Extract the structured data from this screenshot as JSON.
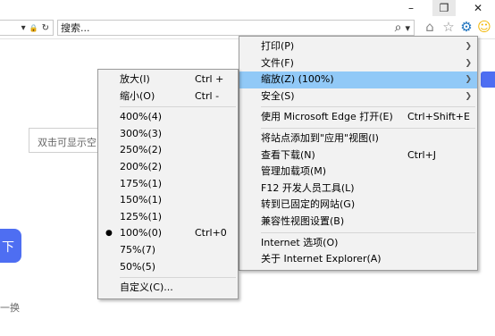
{
  "window": {
    "minimize_glyph": "–",
    "restore_glyph": "❐",
    "close_glyph": "✕"
  },
  "address": {
    "dropdown_glyph": "▾",
    "lock_glyph": "🔒",
    "refresh_glyph": "↻"
  },
  "search": {
    "placeholder": "搜索...",
    "search_glyph": "⌕",
    "dropdown_glyph": "▾"
  },
  "toolbar": {
    "home_glyph": "⌂",
    "favorites_glyph": "☆",
    "tools_glyph": "⚙",
    "smiley_glyph": "☺"
  },
  "page": {
    "input_placeholder": "双击可显示空白",
    "button_label": "下",
    "link_text": "一换"
  },
  "main_menu": {
    "items": [
      {
        "label": "打印(P)",
        "submenu": true
      },
      {
        "label": "文件(F)",
        "submenu": true
      },
      {
        "label": "缩放(Z) (100%)",
        "submenu": true,
        "highlighted": true
      },
      {
        "label": "安全(S)",
        "submenu": true
      },
      {
        "separator": true
      },
      {
        "label": "使用 Microsoft Edge 打开(E)",
        "shortcut": "Ctrl+Shift+E"
      },
      {
        "separator": true
      },
      {
        "label": "将站点添加到\"应用\"视图(I)"
      },
      {
        "label": "查看下载(N)",
        "shortcut": "Ctrl+J"
      },
      {
        "label": "管理加载项(M)"
      },
      {
        "label": "F12 开发人员工具(L)"
      },
      {
        "label": "转到已固定的网站(G)"
      },
      {
        "label": "兼容性视图设置(B)"
      },
      {
        "separator": true
      },
      {
        "label": "Internet 选项(O)"
      },
      {
        "label": "关于 Internet Explorer(A)"
      }
    ]
  },
  "zoom_menu": {
    "items": [
      {
        "label": "放大(I)",
        "shortcut": "Ctrl +"
      },
      {
        "label": "缩小(O)",
        "shortcut": "Ctrl -"
      },
      {
        "separator": true
      },
      {
        "label": "400%(4)"
      },
      {
        "label": "300%(3)"
      },
      {
        "label": "250%(2)"
      },
      {
        "label": "200%(2)"
      },
      {
        "label": "175%(1)"
      },
      {
        "label": "150%(1)"
      },
      {
        "label": "125%(1)"
      },
      {
        "label": "100%(0)",
        "shortcut": "Ctrl+0",
        "selected": true
      },
      {
        "label": "75%(7)"
      },
      {
        "label": "50%(5)"
      },
      {
        "separator": true
      },
      {
        "label": "自定义(C)..."
      }
    ]
  },
  "colors": {
    "highlight": "#91c9f7",
    "menu_bg": "#f2f2f2",
    "accent_blue": "#4e6ef2",
    "gear_blue": "#1e73be",
    "smiley_yellow": "#f2b705"
  }
}
